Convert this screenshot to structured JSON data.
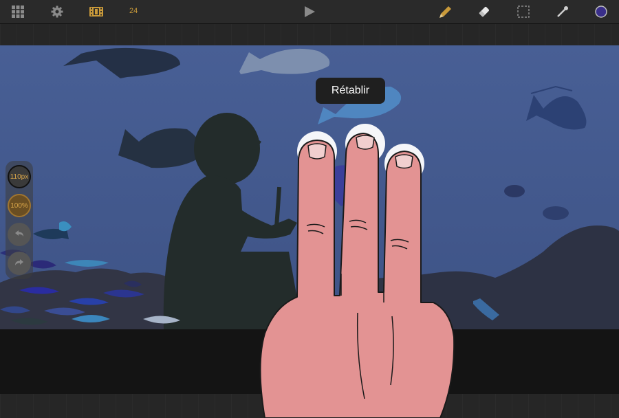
{
  "toolbar": {
    "frame_count": "24",
    "icons": [
      "grid-icon",
      "gear-icon",
      "film-strip-icon",
      "play-icon",
      "pencil-icon",
      "eraser-icon",
      "selection-icon",
      "eyedropper-icon",
      "color-swatch-icon"
    ],
    "colors": {
      "accent": "#c99a3a",
      "swatch": "#3a2f8a"
    }
  },
  "side_tools": {
    "brush_size": "110px",
    "opacity": "100%",
    "icons": [
      "undo-icon",
      "redo-icon"
    ]
  },
  "gesture": {
    "tooltip": "Rétablir",
    "fingers": 3
  }
}
